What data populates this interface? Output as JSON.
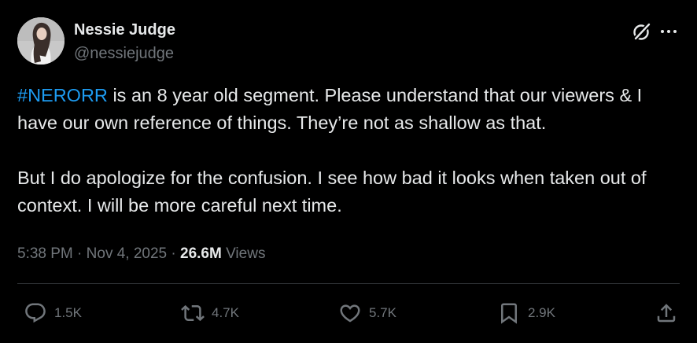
{
  "author": {
    "name": "Nessie Judge",
    "handle": "@nessiejudge"
  },
  "icons": {
    "grok": "grok-icon",
    "more": "more-icon",
    "reply": "reply-icon",
    "retweet": "retweet-icon",
    "like": "heart-icon",
    "bookmark": "bookmark-icon",
    "share": "share-icon"
  },
  "tweet": {
    "hashtag": "#NERORR",
    "paragraph1_rest": " is an 8 year old segment. Please understand that our viewers & I have our own reference of things. They’re not as shallow as that.",
    "paragraph2": "But I do apologize for the confusion. I see how bad it looks when taken out of context. I will be more careful next time."
  },
  "meta": {
    "time": "5:38 PM",
    "separator": " · ",
    "date": "Nov 4, 2025",
    "views_count": "26.6M",
    "views_label": " Views"
  },
  "actions": {
    "replies": "1.5K",
    "reposts": "4.7K",
    "likes": "5.7K",
    "bookmarks": "2.9K"
  },
  "colors": {
    "background": "#000000",
    "text": "#e7e9ea",
    "muted": "#71767b",
    "link": "#1d9bf0",
    "divider": "#2f3336"
  }
}
